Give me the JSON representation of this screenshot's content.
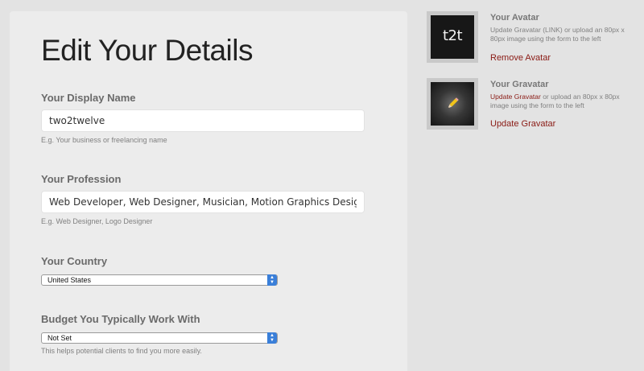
{
  "form": {
    "title": "Edit Your Details",
    "display_name": {
      "label": "Your Display Name",
      "value": "two2twelve",
      "hint": "E.g. Your business or freelancing name"
    },
    "profession": {
      "label": "Your Profession",
      "value": "Web Developer, Web Designer, Musician, Motion Graphics Designer",
      "hint": "E.g. Web Designer, Logo Designer"
    },
    "country": {
      "label": "Your Country",
      "selected": "United States"
    },
    "budget": {
      "label": "Budget You Typically Work With",
      "selected": "Not Set",
      "hint": "This helps potential clients to find you more easily."
    }
  },
  "sidebar": {
    "avatar": {
      "image_text": "t2t",
      "title": "Your Avatar",
      "description": "Update Gravatar (LINK) or upload an 80px x 80px image using the form to the left",
      "action": "Remove Avatar"
    },
    "gravatar": {
      "title": "Your Gravatar",
      "description_link": "Update Gravatar",
      "description_rest": " or upload an 80px x 80px image using the form to the left",
      "action": "Update Gravatar",
      "icon": "pencil-icon"
    }
  },
  "colors": {
    "link": "#8a1a14",
    "select_stepper": "#3a7fd9"
  }
}
